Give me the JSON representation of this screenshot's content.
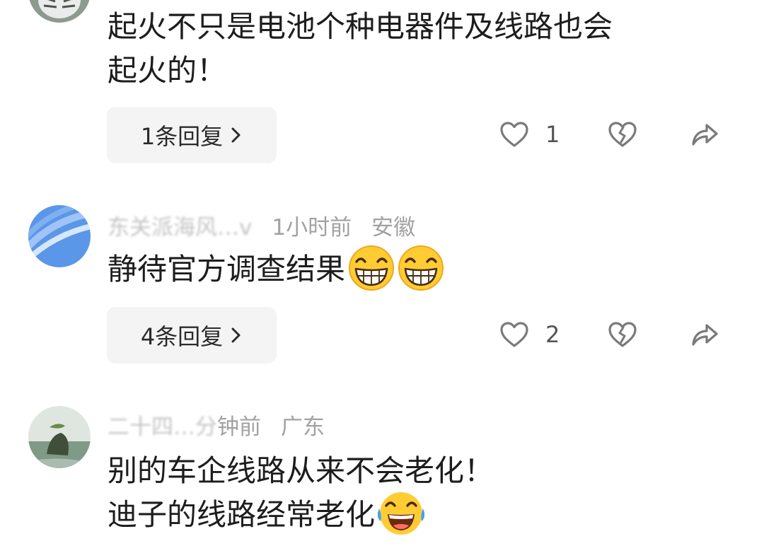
{
  "comments": [
    {
      "text_lines": [
        "起火不只是电池个种电器件及线路也会",
        "起火的！"
      ],
      "reply_label": "1条回复",
      "like_count": "1",
      "avatar_icon": "tiger-avatar-icon"
    },
    {
      "user": "东关派海风…v",
      "time": "1小时前",
      "location": "安徽",
      "text_lines": [
        "静待官方调查结果"
      ],
      "emojis": [
        "grinning-face-icon",
        "grinning-face-icon"
      ],
      "reply_label": "4条回复",
      "like_count": "2",
      "avatar_icon": "blue-waves-avatar-icon"
    },
    {
      "user": "二十四…分",
      "time": "钟前",
      "location": "广东",
      "text_lines": [
        "别的车企线路从来不会老化！",
        "迪子的线路经常老化"
      ],
      "emojis": [
        "tears-of-joy-icon"
      ],
      "avatar_icon": "landscape-avatar-icon"
    }
  ],
  "colors": {
    "reply_bg": "#f4f4f4",
    "meta_text": "#a2a2a2",
    "icon_gray": "#7a7a7a"
  },
  "icons": [
    "like-heart-icon",
    "dislike-broken-heart-icon",
    "share-arrow-icon",
    "chevron-right-icon"
  ]
}
